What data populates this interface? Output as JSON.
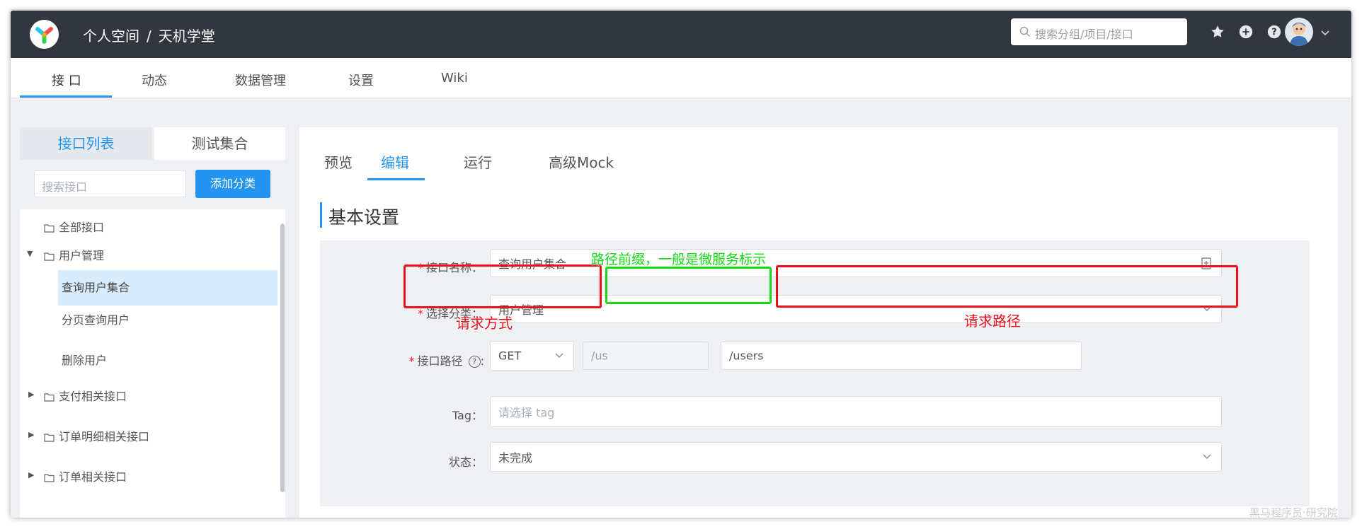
{
  "header": {
    "breadcrumb": [
      "个人空间",
      "天机学堂"
    ],
    "breadcrumb_sep": "/",
    "search_placeholder": "搜索分组/项目/接口",
    "icons": [
      "star-icon",
      "plus-circle-icon",
      "help-icon",
      "avatar",
      "chevron-down-icon"
    ]
  },
  "main_nav": {
    "items": [
      {
        "label": "接 口",
        "active": true
      },
      {
        "label": "动态"
      },
      {
        "label": "数据管理"
      },
      {
        "label": "设置"
      },
      {
        "label": "Wiki"
      }
    ]
  },
  "sidebar": {
    "tabs": [
      {
        "label": "接口列表",
        "active": true
      },
      {
        "label": "测试集合"
      }
    ],
    "search_placeholder": "搜索接口",
    "add_button": "添加分类",
    "tree": [
      {
        "label": "全部接口"
      },
      {
        "label": "用户管理",
        "expanded": true,
        "children": [
          {
            "label": "查询用户集合",
            "selected": true
          },
          {
            "label": "分页查询用户"
          },
          {
            "label": "删除用户"
          }
        ]
      },
      {
        "label": "支付相关接口"
      },
      {
        "label": "订单明细相关接口"
      },
      {
        "label": "订单相关接口"
      }
    ]
  },
  "editor": {
    "tabs": [
      {
        "label": "预览"
      },
      {
        "label": "编辑",
        "active": true
      },
      {
        "label": "运行"
      },
      {
        "label": "高级Mock"
      }
    ],
    "section_title": "基本设置",
    "fields": {
      "name": {
        "label": "接口名称：",
        "value": "查询用户集合",
        "required": "*"
      },
      "category": {
        "label": "选择分类：",
        "value": "用户管理",
        "required": "*"
      },
      "path": {
        "label": "接口路径",
        "help": "?",
        "colon": ":",
        "method": "GET",
        "prefix": "/us",
        "value": "/users",
        "required": "*"
      },
      "tag": {
        "label": "Tag：",
        "placeholder": "请选择 tag"
      },
      "status": {
        "label": "状态：",
        "value": "未完成"
      }
    }
  },
  "annotations": {
    "prefix_note": "路径前缀，一般是微服务标示",
    "method_note": "请求方式",
    "path_note": "请求路径",
    "colors": {
      "red": "#e8111a",
      "green": "#14d914"
    }
  },
  "watermark": "黑马程序员·研究院"
}
